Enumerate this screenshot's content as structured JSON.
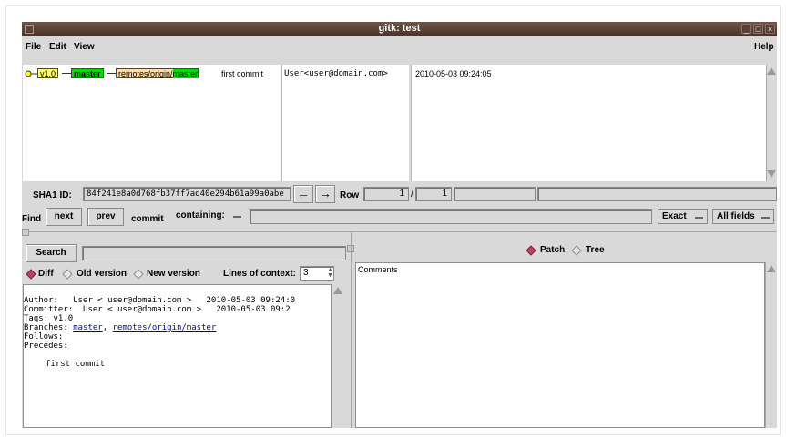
{
  "window": {
    "title": "gitk: test"
  },
  "menu": {
    "file": "File",
    "edit": "Edit",
    "view": "View",
    "help": "Help"
  },
  "graph": {
    "tags": {
      "tag": "v1.0",
      "head": "master",
      "remote_prefix": "remotes/origin/",
      "remote_branch": "master"
    },
    "commit_message": "first commit",
    "author": "User<user@domain.com>",
    "date": "2010-05-03 09:24:05"
  },
  "sha": {
    "label": "SHA1 ID:",
    "value": "84f241e8a0d768fb37ff7ad40e294b61a99a0abe",
    "row_label": "Row",
    "row": "1",
    "sep": "/",
    "total": "1"
  },
  "find": {
    "label": "Find",
    "next": "next",
    "prev": "prev",
    "commit": "commit",
    "containing": "containing:",
    "exact": "Exact",
    "fields": "All fields"
  },
  "search": {
    "button": "Search"
  },
  "diff_options": {
    "diff": "Diff",
    "old": "Old version",
    "new": "New version",
    "context_label": "Lines of context:",
    "context_value": "3"
  },
  "right_options": {
    "patch": "Patch",
    "tree": "Tree"
  },
  "details": {
    "author_label": "Author:",
    "author_value": "User < user@domain.com >",
    "author_date": "2010-05-03 09:24:0",
    "committer_label": "Committer:",
    "committer_value": "User < user@domain.com >",
    "committer_date": "2010-05-03 09:2",
    "tags_line": "Tags: v1.0",
    "branches_label": "Branches:",
    "branch1": "master",
    "branch_sep": ", ",
    "branch2": "remotes/origin/master",
    "follows": "Follows:",
    "precedes": "Precedes:",
    "message": "first commit"
  },
  "files": {
    "comments": "Comments"
  },
  "colors": {
    "titlebar": "#4a3127",
    "tag": "#ffff66",
    "head": "#00dd00",
    "remote": "#ffddaa",
    "link": "#0000c0"
  }
}
